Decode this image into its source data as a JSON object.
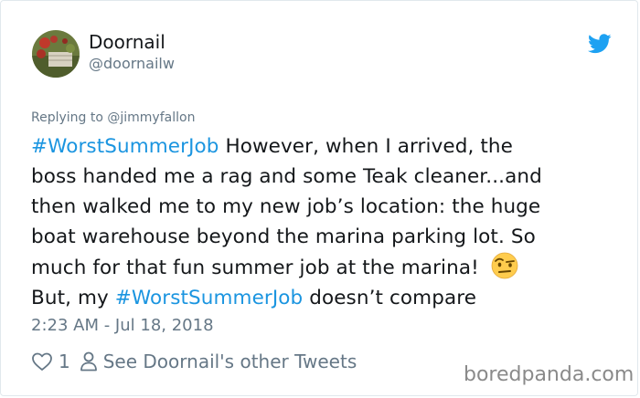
{
  "author": {
    "display_name": "Doornail",
    "handle": "@doornailw"
  },
  "reply_to": "Replying to @jimmyfallon",
  "tweet": {
    "lines": [
      {
        "hashtag": "#WorstSummerJob",
        "text": " However, when I arrived, the"
      },
      {
        "text": "boss handed me a rag and some Teak cleaner...and"
      },
      {
        "text": "then walked me to my new job’s location: the huge"
      },
      {
        "text": "boat warehouse beyond the marina parking lot. So"
      },
      {
        "text": "much for that fun summer job at the marina! "
      },
      {
        "prefix": "But, my ",
        "hashtag": "#WorstSummerJob",
        "text": " doesn’t compare"
      }
    ],
    "emoji": "raised-eyebrow-face"
  },
  "timestamp": "2:23 AM - Jul 18, 2018",
  "actions": {
    "like_count": "1",
    "see_other_label": "See Doornail's other Tweets"
  },
  "watermark": "boredpanda.com",
  "colors": {
    "link": "#1b95e0",
    "text": "#14171a",
    "muted": "#657786"
  }
}
